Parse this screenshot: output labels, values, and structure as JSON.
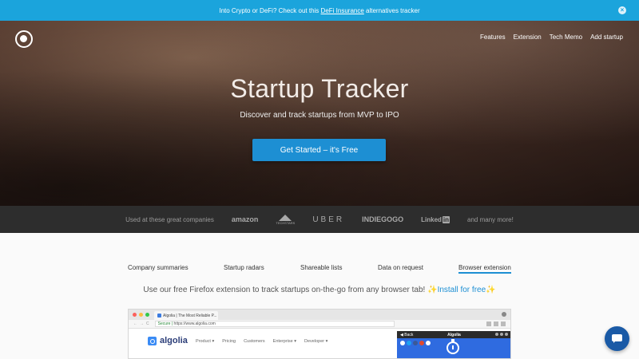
{
  "banner": {
    "text_before": "Into Crypto or DeFi? Check out this",
    "link_text": "DeFi Insurance",
    "text_after": "alternatives tracker",
    "close_glyph": "×"
  },
  "header": {
    "logo_icon": "circle-logo-icon",
    "nav": [
      "Features",
      "Extension",
      "Tech Memo",
      "Add startup"
    ]
  },
  "hero": {
    "title": "Startup Tracker",
    "subtitle": "Discover and track startups from MVP to IPO",
    "cta_label": "Get Started – it's Free"
  },
  "used_by": {
    "lead": "Used at these great companies",
    "companies": [
      "amazon",
      "TECHSTARS",
      "UBER",
      "INDIEGOGO",
      "Linked",
      "in"
    ],
    "tail": "and many more!"
  },
  "features": {
    "tabs": [
      "Company summaries",
      "Startup radars",
      "Shareable lists",
      "Data on request",
      "Browser extension"
    ],
    "active_tab": "Browser extension",
    "tagline_text": "Use our free Firefox extension to track startups on-the-go from any browser tab!",
    "install_text": "Install for free",
    "sparkle": "✨"
  },
  "browser_preview": {
    "tab_title": "Algolia | The Most Reliable P...",
    "nav_glyphs": "←→C",
    "url_secure": "Secure",
    "url": "https://www.algolia.com",
    "site_name": "algolia",
    "menu": [
      "Product ▾",
      "Pricing",
      "Customers",
      "Enterprise ▾",
      "Developer ▾"
    ],
    "ext_back": "◀ Back",
    "ext_title": "Algolia"
  },
  "colors": {
    "banner": "#1ba4dc",
    "cta": "#1d8fd3",
    "used_bar": "#2d2d2d",
    "chat": "#1a5aa6"
  },
  "chat": {
    "icon": "chat-bubble-icon"
  }
}
